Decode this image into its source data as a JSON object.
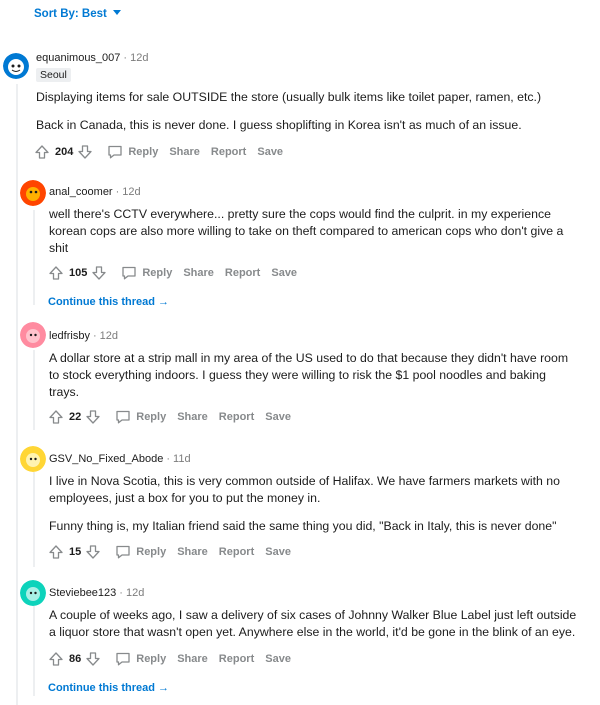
{
  "sort": {
    "label": "Sort By: Best"
  },
  "actions": {
    "reply": "Reply",
    "share": "Share",
    "report": "Report",
    "save": "Save"
  },
  "continue_label": "Continue this thread",
  "comments": [
    {
      "username": "equanimous_007",
      "time": "12d",
      "flair": "Seoul",
      "paragraphs": [
        "Displaying items for sale OUTSIDE the store (usually bulk items like toilet paper, ramen, etc.)",
        "Back in Canada, this is never done. I guess shoplifting in Korea isn't as much of an issue."
      ],
      "score": "204",
      "avatar_color": "#0079d3"
    },
    {
      "username": "anal_coomer",
      "time": "12d",
      "paragraphs": [
        "well there's CCTV everywhere... pretty sure the cops would find the culprit. in my experience korean cops are also more willing to take on theft compared to american cops who don't give a shit"
      ],
      "score": "105",
      "avatar_color": "#ff4500"
    },
    {
      "username": "ledfrisby",
      "time": "12d",
      "paragraphs": [
        "A dollar store at a strip mall in my area of the US used to do that because they didn't have room to stock everything indoors. I guess they were willing to risk the $1 pool noodles and baking trays."
      ],
      "score": "22",
      "avatar_color": "#ff8ba0"
    },
    {
      "username": "GSV_No_Fixed_Abode",
      "time": "11d",
      "paragraphs": [
        "I live in Nova Scotia, this is very common outside of Halifax. We have farmers markets with no employees, just a box for you to put the money in.",
        "Funny thing is, my Italian friend said the same thing you did, \"Back in Italy, this is never done\""
      ],
      "score": "15",
      "avatar_color": "#ffd635"
    },
    {
      "username": "Steviebee123",
      "time": "12d",
      "paragraphs": [
        "A couple of weeks ago, I saw a delivery of six cases of Johnny Walker Blue Label just left outside a liquor store that wasn't open yet. Anywhere else in the world, it'd be gone in the blink of an eye."
      ],
      "score": "86",
      "avatar_color": "#0dd3bb"
    }
  ],
  "colors": {
    "link": "#0079d3",
    "muted": "#878a8c",
    "thread_line": "#edeff1"
  }
}
